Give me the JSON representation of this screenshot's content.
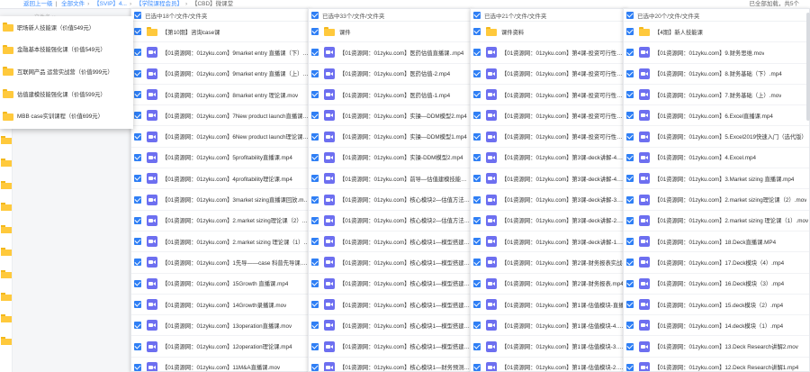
{
  "topbar": {
    "crumbs": [
      "返回上一级",
      "全部文件",
      "【SVIP】4...",
      "",
      "【学院课程会员】"
    ],
    "current": "【CBD】微课堂",
    "status": "已全部加载，共5个"
  },
  "background_label": "文件名 ∨",
  "menu": {
    "items": [
      "职场新人技能课（价值549元）",
      "金融基本技能强化课（价值549元）",
      "互联网产品 运营实战营（价值999元）",
      "估值建模技能强化课（价值599元）",
      "MBB case实训课程（价值699元）"
    ]
  },
  "panels": [
    {
      "header": "已选中18个/文件/文件夹",
      "rows": [
        {
          "type": "folder",
          "name": "【第10期】咨询case课"
        },
        {
          "type": "video",
          "name": "【01资源网：01zyku.com】9market entry 直播课（下）.mp4"
        },
        {
          "type": "video",
          "name": "【01资源网：01zyku.com】9market entry 直播课（上）.mp4"
        },
        {
          "type": "video",
          "name": "【01资源网：01zyku.com】8market entry 理论课.mov"
        },
        {
          "type": "video",
          "name": "【01资源网：01zyku.com】7New product launch直播课.mp4"
        },
        {
          "type": "video",
          "name": "【01资源网：01zyku.com】6New product launch理论课.mov"
        },
        {
          "type": "video",
          "name": "【01资源网：01zyku.com】5profitability直播课.mp4"
        },
        {
          "type": "video",
          "name": "【01资源网：01zyku.com】4profitability理论课.mp4"
        },
        {
          "type": "video",
          "name": "【01资源网：01zyku.com】3market sizing直播课回放.mov"
        },
        {
          "type": "video",
          "name": "【01资源网：01zyku.com】2.market sizing理论课（2）.mov"
        },
        {
          "type": "video",
          "name": "【01资源网：01zyku.com】2.market sizing 理论课（1）.mov"
        },
        {
          "type": "video",
          "name": "【01资源网：01zyku.com】1先导——case 科普先导课.mov"
        },
        {
          "type": "video",
          "name": "【01资源网：01zyku.com】15Growth 直播课.mp4"
        },
        {
          "type": "video",
          "name": "【01资源网：01zyku.com】14Growth录播课.mov"
        },
        {
          "type": "video",
          "name": "【01资源网：01zyku.com】13operation直播课.mov"
        },
        {
          "type": "video",
          "name": "【01资源网：01zyku.com】12operation理论课.mp4"
        },
        {
          "type": "video",
          "name": "【01资源网：01zyku.com】11M&A直播课.mov"
        }
      ]
    },
    {
      "header": "已选中33个/文件/文件夹",
      "rows": [
        {
          "type": "folder",
          "name": "课件"
        },
        {
          "type": "video",
          "name": "【01资源网：01zyku.com】医药估值直播课..mp4"
        },
        {
          "type": "video",
          "name": "【01资源网：01zyku.com】医药估值-2.mp4"
        },
        {
          "type": "video",
          "name": "【01资源网：01zyku.com】医药估值-1.mp4"
        },
        {
          "type": "video",
          "name": "【01资源网：01zyku.com】实操—DDM模型2.mp4"
        },
        {
          "type": "video",
          "name": "【01资源网：01zyku.com】实操—DDM模型1.mp4"
        },
        {
          "type": "video",
          "name": "【01资源网：01zyku.com】实操-DDM模型2.mp4"
        },
        {
          "type": "video",
          "name": "【01资源网：01zyku.com】前导—估值建模技能应用"
        },
        {
          "type": "video",
          "name": "【01资源网：01zyku.com】核心模块2—估值方法基础"
        },
        {
          "type": "video",
          "name": "【01资源网：01zyku.com】核心模块2—估值方法基础"
        },
        {
          "type": "video",
          "name": "【01资源网：01zyku.com】核心模块1—模型搭建Exc"
        },
        {
          "type": "video",
          "name": "【01资源网：01zyku.com】核心模块1—模型搭建Exc"
        },
        {
          "type": "video",
          "name": "【01资源网：01zyku.com】核心模块1—模型搭建Exc"
        },
        {
          "type": "video",
          "name": "【01资源网：01zyku.com】核心模块1—模型搭建Exc"
        },
        {
          "type": "video",
          "name": "【01资源网：01zyku.com】核心模块1—模型搭建Exc"
        },
        {
          "type": "video",
          "name": "【01资源网：01zyku.com】核心模块1—模型搭建Exc"
        },
        {
          "type": "video",
          "name": "【01资源网：01zyku.com】核心模块1—财务预测（2"
        }
      ]
    },
    {
      "header": "已选中21个/文件/文件夹",
      "rows": [
        {
          "type": "folder",
          "name": "课件资料"
        },
        {
          "type": "video",
          "name": "【01资源网：01zyku.com】第4课-投资可行性报告"
        },
        {
          "type": "video",
          "name": "【01资源网：01zyku.com】第4课-投资可行性报告"
        },
        {
          "type": "video",
          "name": "【01资源网：01zyku.com】第4课-投资可行性报告"
        },
        {
          "type": "video",
          "name": "【01资源网：01zyku.com】第4课-投资可行性报告"
        },
        {
          "type": "video",
          "name": "【01资源网：01zyku.com】第4课-投资可行性报告"
        },
        {
          "type": "video",
          "name": "【01资源网：01zyku.com】第3课-deck讲解-4.mp4"
        },
        {
          "type": "video",
          "name": "【01资源网：01zyku.com】第3课-deck讲解-4.mp4"
        },
        {
          "type": "video",
          "name": "【01资源网：01zyku.com】第3课-deck讲解-3.mp4"
        },
        {
          "type": "video",
          "name": "【01资源网：01zyku.com】第3课-deck讲解-2.mp4"
        },
        {
          "type": "video",
          "name": "【01资源网：01zyku.com】第3课-deck讲解-1.mp4"
        },
        {
          "type": "video",
          "name": "【01资源网：01zyku.com】第2课-财务报表实战-"
        },
        {
          "type": "video",
          "name": "【01资源网：01zyku.com】第2课-财务报表.mp4"
        },
        {
          "type": "video",
          "name": "【01资源网：01zyku.com】第1课-估值模块-直播"
        },
        {
          "type": "video",
          "name": "【01资源网：01zyku.com】第1课-估值模块-4.mp4"
        },
        {
          "type": "video",
          "name": "【01资源网：01zyku.com】第1课-估值模块-3.mp4"
        },
        {
          "type": "video",
          "name": "【01资源网：01zyku.com】第1课-估值模块-2.mp4"
        }
      ]
    },
    {
      "header": "已选中20个/文件/文件夹",
      "rows": [
        {
          "type": "folder",
          "name": "【4期】新人技能课"
        },
        {
          "type": "video",
          "name": "【01资源网：01zyku.com】9.财务思维.mov"
        },
        {
          "type": "video",
          "name": "【01资源网：01zyku.com】8.财务基础（下）.mp4"
        },
        {
          "type": "video",
          "name": "【01资源网：01zyku.com】7.财务基础（上）.mov"
        },
        {
          "type": "video",
          "name": "【01资源网：01zyku.com】6.Excel直播课.mp4"
        },
        {
          "type": "video",
          "name": "【01资源网：01zyku.com】5.Excel2019快速入门（选代版）"
        },
        {
          "type": "video",
          "name": "【01资源网：01zyku.com】4.Excel.mp4"
        },
        {
          "type": "video",
          "name": "【01资源网：01zyku.com】3.Market sizing 直播课.mp4"
        },
        {
          "type": "video",
          "name": "【01资源网：01zyku.com】2.market sizing理论课（2）.mov"
        },
        {
          "type": "video",
          "name": "【01资源网：01zyku.com】2.market sizing 理论课（1）.mov"
        },
        {
          "type": "video",
          "name": "【01资源网：01zyku.com】18.Deck直播课.MP4"
        },
        {
          "type": "video",
          "name": "【01资源网：01zyku.com】17.Deck模块（4）.mp4"
        },
        {
          "type": "video",
          "name": "【01资源网：01zyku.com】16.Deck模块（3）.mp4"
        },
        {
          "type": "video",
          "name": "【01资源网：01zyku.com】15.deck模块（2）.mp4"
        },
        {
          "type": "video",
          "name": "【01资源网：01zyku.com】14.deck模块（1）.mp4"
        },
        {
          "type": "video",
          "name": "【01资源网：01zyku.com】13.Deck Research讲解2.mov"
        },
        {
          "type": "video",
          "name": "【01资源网：01zyku.com】12.Deck Research讲解1.mp4"
        }
      ]
    }
  ]
}
